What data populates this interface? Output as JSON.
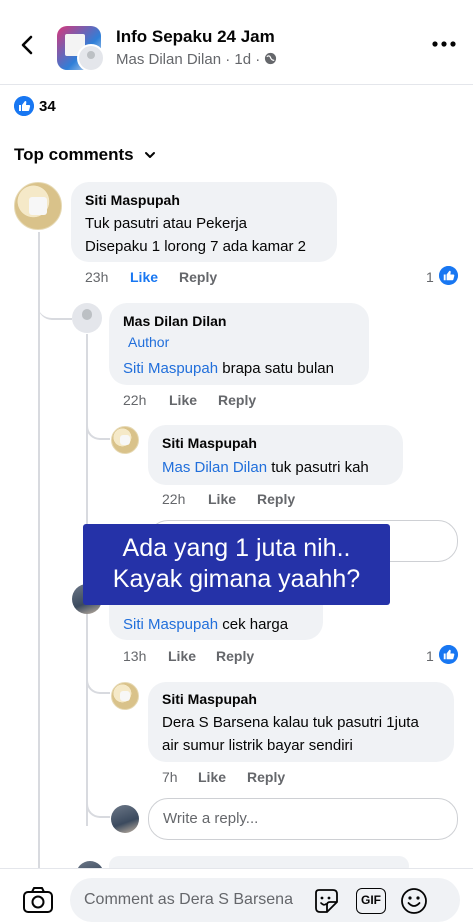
{
  "header": {
    "group_name": "Info Sepaku 24 Jam",
    "poster": "Mas Dilan Dilan",
    "time": "1d",
    "separator": "·"
  },
  "reactions": {
    "count": "34"
  },
  "sort": {
    "label": "Top comments"
  },
  "comments": [
    {
      "name": "Siti Maspupah",
      "lines": [
        "Tuk pasutri atau Pekerja",
        "Disepaku 1 lorong 7 ada kamar 2"
      ],
      "time": "23h",
      "like": "Like",
      "reply": "Reply",
      "likes": "1"
    },
    {
      "name": "Mas Dilan Dilan",
      "badge": "Author",
      "mention": "Siti Maspupah",
      "text": " brapa satu bulan",
      "time": "22h",
      "like": "Like",
      "reply": "Reply"
    },
    {
      "name": "Siti Maspupah",
      "mention": "Mas Dilan Dilan",
      "text": " tuk pasutri kah",
      "time": "22h",
      "like": "Like",
      "reply": "Reply"
    },
    {
      "mention": "Siti Maspupah",
      "text": " cek harga",
      "time": "13h",
      "like": "Like",
      "reply": "Reply",
      "likes": "1"
    },
    {
      "name": "Siti Maspupah",
      "lines": [
        "Dera S Barsena kalau tuk pasutri 1juta",
        "air sumur listrik bayar sendiri"
      ],
      "time": "7h",
      "like": "Like",
      "reply": "Reply"
    }
  ],
  "overlay": {
    "line1": "Ada yang 1 juta nih..",
    "line2": "Kayak gimana yaahh?"
  },
  "reply_box": {
    "placeholder": "Write a reply..."
  },
  "composer": {
    "placeholder": "Comment as Dera S Barsena",
    "gif_label": "GIF"
  },
  "colors": {
    "accent": "#1877f2",
    "overlay_bg": "#2532a8",
    "bubble": "#f0f2f5"
  }
}
